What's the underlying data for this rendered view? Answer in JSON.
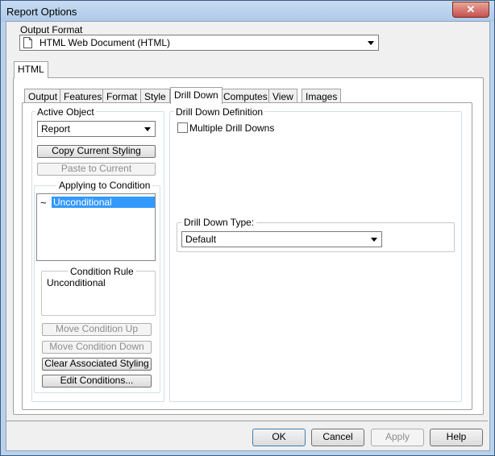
{
  "window": {
    "title": "Report Options",
    "close": "✕"
  },
  "output_format": {
    "label": "Output Format",
    "value": "HTML Web Document (HTML)"
  },
  "main_tab": "HTML",
  "tabs": [
    "Output",
    "Features",
    "Format",
    "Style",
    "Drill Down",
    "Computes",
    "View",
    "Images"
  ],
  "active_tab": "Drill Down",
  "active_object": {
    "label": "Active Object",
    "value": "Report",
    "copy_styling": "Copy Current Styling",
    "paste": "Paste to Current"
  },
  "applying": {
    "label": "Applying to Condition",
    "items": [
      {
        "symbol": "~",
        "text": "Unconditional"
      }
    ]
  },
  "condition_rule": {
    "label": "Condition Rule",
    "text": "Unconditional"
  },
  "condition_buttons": {
    "move_up": "Move Condition Up",
    "move_down": "Move Condition Down",
    "clear": "Clear Associated Styling",
    "edit": "Edit Conditions..."
  },
  "drill_down": {
    "label": "Drill Down Definition",
    "multiple": "Multiple Drill Downs",
    "type_label": "Drill Down Type:",
    "type_value": "Default"
  },
  "footer": {
    "ok": "OK",
    "cancel": "Cancel",
    "apply": "Apply",
    "help": "Help"
  }
}
